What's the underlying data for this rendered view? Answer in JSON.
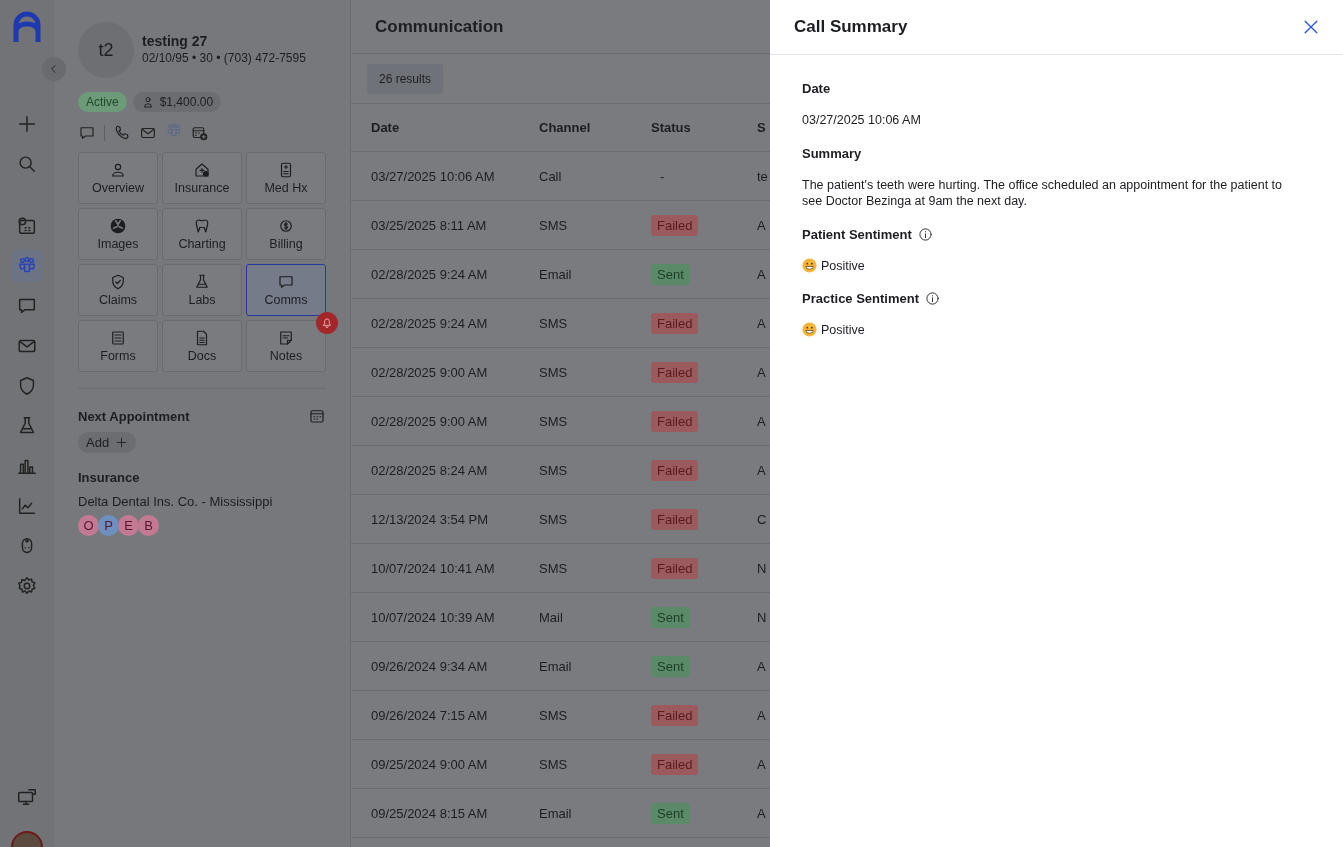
{
  "rail": {
    "items": [
      {
        "kind": "add",
        "selected": false
      },
      {
        "kind": "search",
        "selected": false
      },
      {
        "kind": "schedule",
        "selected": false
      },
      {
        "kind": "patients",
        "selected": true
      },
      {
        "kind": "chat",
        "selected": false
      },
      {
        "kind": "mail",
        "selected": false
      },
      {
        "kind": "shield",
        "selected": false
      },
      {
        "kind": "flask",
        "selected": false
      },
      {
        "kind": "bars",
        "selected": false
      },
      {
        "kind": "linechart",
        "selected": false
      },
      {
        "kind": "doctor",
        "selected": false
      },
      {
        "kind": "settings",
        "selected": false
      }
    ]
  },
  "patient": {
    "initials": "t2",
    "name": "testing 27",
    "details": "02/10/95 • 30 • (703) 472-7595",
    "status": "Active",
    "balance": "$1,400.00",
    "tiles": [
      {
        "label": "Overview",
        "kind": "person",
        "selected": false,
        "alert": false
      },
      {
        "label": "Insurance",
        "kind": "house",
        "selected": false,
        "alert": false
      },
      {
        "label": "Med Hx",
        "kind": "record",
        "selected": false,
        "alert": false
      },
      {
        "label": "Images",
        "kind": "radiation",
        "selected": false,
        "alert": false
      },
      {
        "label": "Charting",
        "kind": "tooth",
        "selected": false,
        "alert": false
      },
      {
        "label": "Billing",
        "kind": "dollar",
        "selected": false,
        "alert": false
      },
      {
        "label": "Claims",
        "kind": "shield",
        "selected": false,
        "alert": false
      },
      {
        "label": "Labs",
        "kind": "flask",
        "selected": false,
        "alert": false
      },
      {
        "label": "Comms",
        "kind": "chat",
        "selected": true,
        "alert": false
      },
      {
        "label": "Forms",
        "kind": "form",
        "selected": false,
        "alert": false
      },
      {
        "label": "Docs",
        "kind": "doc",
        "selected": false,
        "alert": false
      },
      {
        "label": "Notes",
        "kind": "note",
        "selected": false,
        "alert": true
      }
    ],
    "next_appointment": {
      "title": "Next Appointment",
      "button": "Add"
    },
    "insurance": {
      "title": "Insurance",
      "carrier": "Delta Dental Ins. Co. - Mississippi",
      "badges": [
        {
          "letter": "O",
          "color": "#c27a92"
        },
        {
          "letter": "P",
          "color": "#6f8fbf"
        },
        {
          "letter": "E",
          "color": "#c27a92"
        },
        {
          "letter": "B",
          "color": "#c27a92"
        }
      ]
    }
  },
  "communication": {
    "title": "Communication",
    "results": "26 results",
    "columns": [
      "Date",
      "Channel",
      "Status",
      "S"
    ],
    "rows": [
      {
        "date": "03/27/2025 10:06 AM",
        "channel": "Call",
        "status": {
          "text": "-",
          "kind": "none"
        },
        "column_4": "te"
      },
      {
        "date": "03/25/2025 8:11 AM",
        "channel": "SMS",
        "status": {
          "text": "Failed",
          "kind": "failed"
        },
        "column_4": "A"
      },
      {
        "date": "02/28/2025 9:24 AM",
        "channel": "Email",
        "status": {
          "text": "Sent",
          "kind": "sent"
        },
        "column_4": "A"
      },
      {
        "date": "02/28/2025 9:24 AM",
        "channel": "SMS",
        "status": {
          "text": "Failed",
          "kind": "failed"
        },
        "column_4": "A"
      },
      {
        "date": "02/28/2025 9:00 AM",
        "channel": "SMS",
        "status": {
          "text": "Failed",
          "kind": "failed"
        },
        "column_4": "A"
      },
      {
        "date": "02/28/2025 9:00 AM",
        "channel": "SMS",
        "status": {
          "text": "Failed",
          "kind": "failed"
        },
        "column_4": "A"
      },
      {
        "date": "02/28/2025 8:24 AM",
        "channel": "SMS",
        "status": {
          "text": "Failed",
          "kind": "failed"
        },
        "column_4": "A"
      },
      {
        "date": "12/13/2024 3:54 PM",
        "channel": "SMS",
        "status": {
          "text": "Failed",
          "kind": "failed"
        },
        "column_4": "C"
      },
      {
        "date": "10/07/2024 10:41 AM",
        "channel": "SMS",
        "status": {
          "text": "Failed",
          "kind": "failed"
        },
        "column_4": "N"
      },
      {
        "date": "10/07/2024 10:39 AM",
        "channel": "Mail",
        "status": {
          "text": "Sent",
          "kind": "sent"
        },
        "column_4": "N"
      },
      {
        "date": "09/26/2024 9:34 AM",
        "channel": "Email",
        "status": {
          "text": "Sent",
          "kind": "sent"
        },
        "column_4": "A"
      },
      {
        "date": "09/26/2024 7:15 AM",
        "channel": "SMS",
        "status": {
          "text": "Failed",
          "kind": "failed"
        },
        "column_4": "A"
      },
      {
        "date": "09/25/2024 9:00 AM",
        "channel": "SMS",
        "status": {
          "text": "Failed",
          "kind": "failed"
        },
        "column_4": "A"
      },
      {
        "date": "09/25/2024 8:15 AM",
        "channel": "Email",
        "status": {
          "text": "Sent",
          "kind": "sent"
        },
        "column_4": "A"
      }
    ]
  },
  "call_summary": {
    "title": "Call Summary",
    "fields": [
      {
        "label": "Date",
        "kind": "text",
        "info": false,
        "value": "03/27/2025 10:06 AM"
      },
      {
        "label": "Summary",
        "kind": "text",
        "info": false,
        "value": "The patient's teeth were hurting. The office scheduled an appointment for the patient to see Doctor Bezinga at 9am the next day."
      },
      {
        "label": "Patient Sentiment",
        "kind": "sentiment",
        "info": true,
        "value": "Positive"
      },
      {
        "label": "Practice Sentiment",
        "kind": "sentiment",
        "info": true,
        "value": "Positive"
      }
    ]
  }
}
